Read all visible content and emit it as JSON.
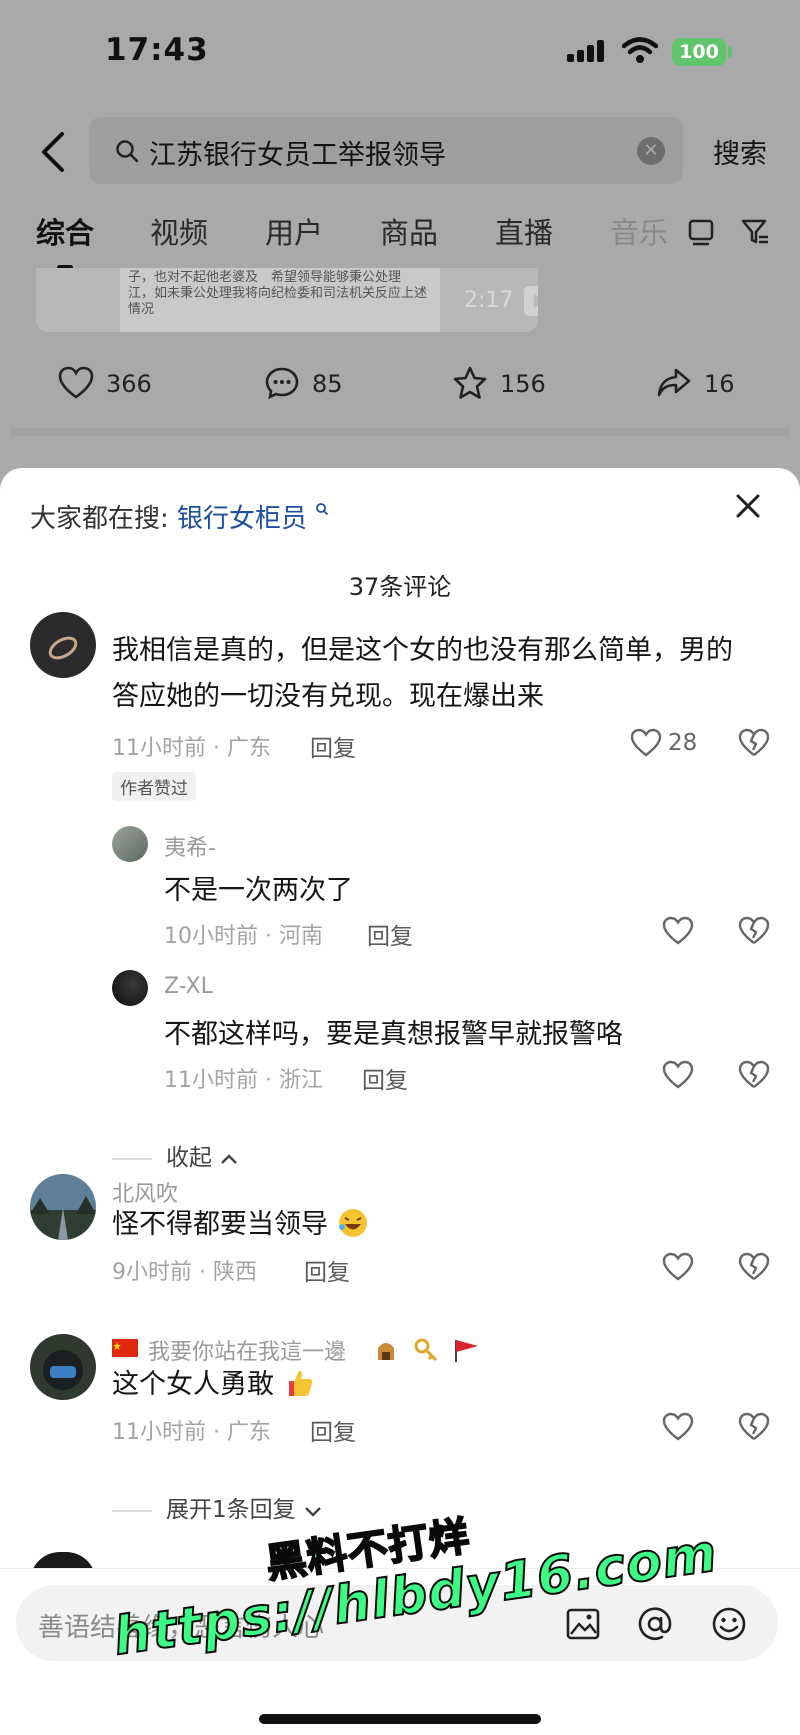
{
  "status_bar": {
    "time": "17:43",
    "battery": "100"
  },
  "search": {
    "query": "江苏银行女员工举报领导",
    "button": "搜索"
  },
  "tabs": [
    {
      "label": "综合"
    },
    {
      "label": "视频"
    },
    {
      "label": "用户"
    },
    {
      "label": "商品"
    },
    {
      "label": "直播"
    },
    {
      "label": "音乐"
    }
  ],
  "video": {
    "snippet": "子，也对不起他老婆及　希望领导能够秉公处理　江，如未秉公处理我将向纪检委和司法机关反应上述情况",
    "duration": "2:17"
  },
  "post_actions": {
    "likes": "366",
    "comments": "85",
    "favorites": "156",
    "shares": "16"
  },
  "sheet": {
    "hot_search_label": "大家都在搜:",
    "hot_search_term": "银行女柜员",
    "comment_count": "37条评论"
  },
  "comments": [
    {
      "text_line1": "我相信是真的，但是这个女的也没有那么简单，男的",
      "text_line2": "答应她的一切没有兑现。现在爆出来",
      "meta": "11小时前 · 广东",
      "reply": "回复",
      "likes": "28",
      "badge": "作者赞过",
      "replies": [
        {
          "user": "夷希-",
          "text": "不是一次两次了",
          "meta": "10小时前 · 河南",
          "reply": "回复"
        },
        {
          "user": "Z-XL",
          "text": "不都这样吗，要是真想报警早就报警咯",
          "meta": "11小时前 · 浙江",
          "reply": "回复"
        }
      ],
      "toggle": "收起"
    },
    {
      "user": "北风吹",
      "text": "怪不得都要当领导",
      "meta": "9小时前 · 陕西",
      "reply": "回复"
    },
    {
      "user": "我要你站在我這一邊",
      "text": "这个女人勇敢",
      "meta": "11小时前 · 广东",
      "reply": "回复",
      "toggle": "展开1条回复"
    }
  ],
  "input": {
    "placeholder": "善语结善缘，恶言伤人心"
  },
  "watermark": {
    "line1": "黑料不打烊",
    "line2": "https://hlbdy16.com"
  },
  "colors": {
    "link_blue": "#1f4fa0",
    "watermark_green": "#3dfc86",
    "battery_green": "#5fc46a"
  }
}
